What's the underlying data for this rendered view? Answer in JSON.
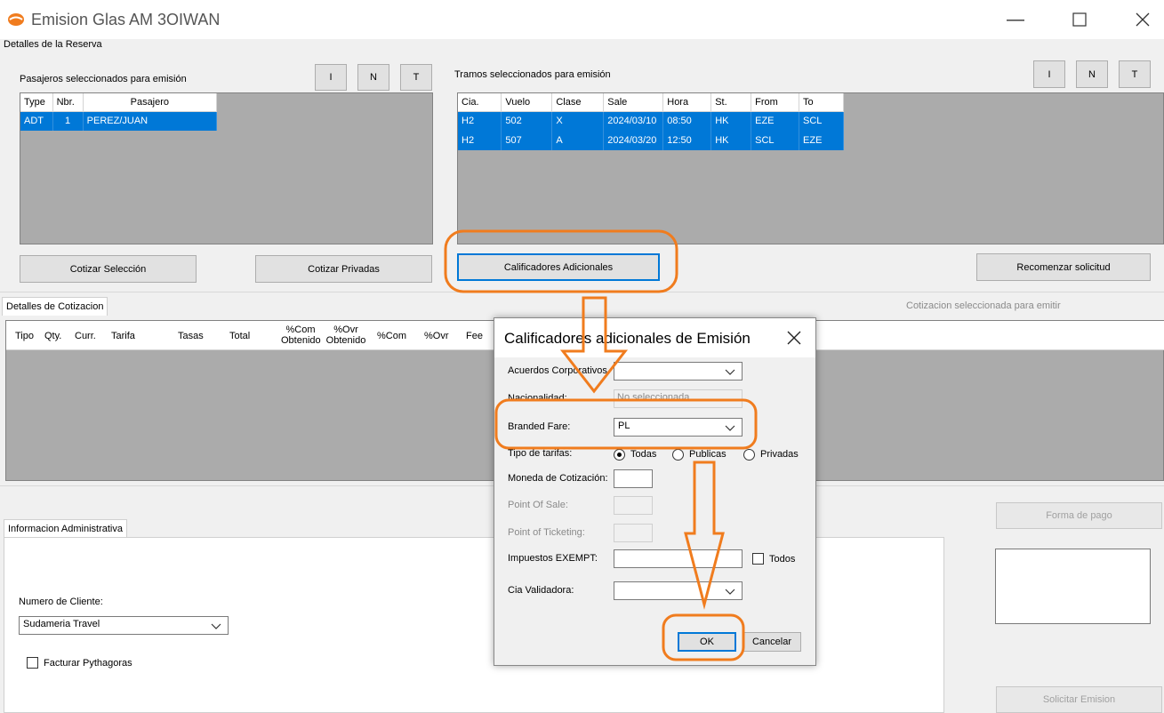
{
  "window": {
    "title": "Emision Glas AM 3OIWAN"
  },
  "section_reserva": "Detalles de la Reserva",
  "pasajeros": {
    "label": "Pasajeros seleccionados para emisión",
    "btn_i": "I",
    "btn_n": "N",
    "btn_t": "T",
    "columns": [
      "Type",
      "Nbr.",
      "Pasajero"
    ],
    "rows": [
      [
        "ADT",
        "1",
        "PEREZ/JUAN"
      ]
    ]
  },
  "tramos": {
    "label": "Tramos seleccionados para emisión",
    "btn_i": "I",
    "btn_n": "N",
    "btn_t": "T",
    "columns": [
      "Cia.",
      "Vuelo",
      "Clase",
      "Sale",
      "Hora",
      "St.",
      "From",
      "To"
    ],
    "rows": [
      [
        "H2",
        "502",
        "X",
        "2024/03/10",
        "08:50",
        "HK",
        "EZE",
        "SCL"
      ],
      [
        "H2",
        "507",
        "A",
        "2024/03/20",
        "12:50",
        "HK",
        "SCL",
        "EZE"
      ]
    ]
  },
  "buttons": {
    "cotizar_seleccion": "Cotizar Selección",
    "cotizar_privadas": "Cotizar Privadas",
    "calificadores": "Calificadores Adicionales",
    "recomenzar": "Recomenzar solicitud",
    "forma_pago": "Forma de pago",
    "solicitar_emision": "Solicitar Emision"
  },
  "cotizacion": {
    "tab": "Detalles de Cotizacion",
    "selected_label": "Cotizacion seleccionada para emitir",
    "columns": [
      "Tipo",
      "Qty.",
      "Curr.",
      "Tarifa",
      "Tasas",
      "Total",
      "%Com Obtenido",
      "%Ovr Obtenido",
      "%Com",
      "%Ovr",
      "Fee"
    ]
  },
  "admin": {
    "tab": "Informacion Administrativa",
    "cliente_label": "Numero de Cliente:",
    "cliente_value": "Sudameria Travel",
    "facturar_label": "Facturar Pythagoras"
  },
  "dialog": {
    "title": "Calificadores adicionales de Emisión",
    "acuerdos_label": "Acuerdos Corporativos",
    "acuerdos_value": "",
    "nacionalidad_label": "Nacionalidad:",
    "nacionalidad_value": "No seleccionada",
    "branded_label": "Branded Fare:",
    "branded_value": "PL",
    "tipo_label": "Tipo de tarifas:",
    "radio_todas": "Todas",
    "radio_publicas": "Publicas",
    "radio_privadas": "Privadas",
    "moneda_label": "Moneda de Cotización:",
    "pos_label": "Point Of Sale:",
    "pot_label": "Point of Ticketing:",
    "impuestos_label": "Impuestos EXEMPT:",
    "todos_label": "Todos",
    "cia_label": "Cia Validadora:",
    "ok": "OK",
    "cancel": "Cancelar"
  },
  "colors": {
    "selection": "#0078d7",
    "annotation": "#f07c1e"
  }
}
